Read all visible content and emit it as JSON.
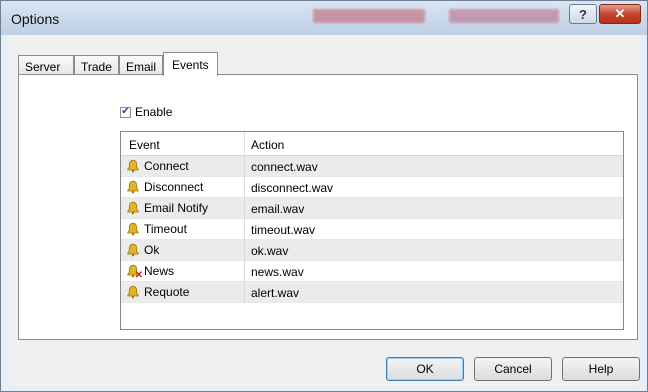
{
  "window": {
    "title": "Options"
  },
  "tabs": [
    {
      "label": "Server"
    },
    {
      "label": "Trade"
    },
    {
      "label": "Email"
    },
    {
      "label": "Events"
    }
  ],
  "active_tab": "Events",
  "enable": {
    "label": "Enable",
    "checked": true
  },
  "table": {
    "columns": [
      "Event",
      "Action"
    ],
    "rows": [
      {
        "event": "Connect",
        "action": "connect.wav",
        "icon": "bell-icon"
      },
      {
        "event": "Disconnect",
        "action": "disconnect.wav",
        "icon": "bell-icon"
      },
      {
        "event": "Email Notify",
        "action": "email.wav",
        "icon": "bell-icon"
      },
      {
        "event": "Timeout",
        "action": "timeout.wav",
        "icon": "bell-icon"
      },
      {
        "event": "Ok",
        "action": "ok.wav",
        "icon": "bell-icon"
      },
      {
        "event": "News",
        "action": "news.wav",
        "icon": "bell-disabled-icon"
      },
      {
        "event": "Requote",
        "action": "alert.wav",
        "icon": "bell-icon"
      }
    ]
  },
  "buttons": {
    "ok": "OK",
    "cancel": "Cancel",
    "help": "Help"
  },
  "colors": {
    "bell": "#e2b425",
    "disabled_mark": "#c81e1e"
  }
}
